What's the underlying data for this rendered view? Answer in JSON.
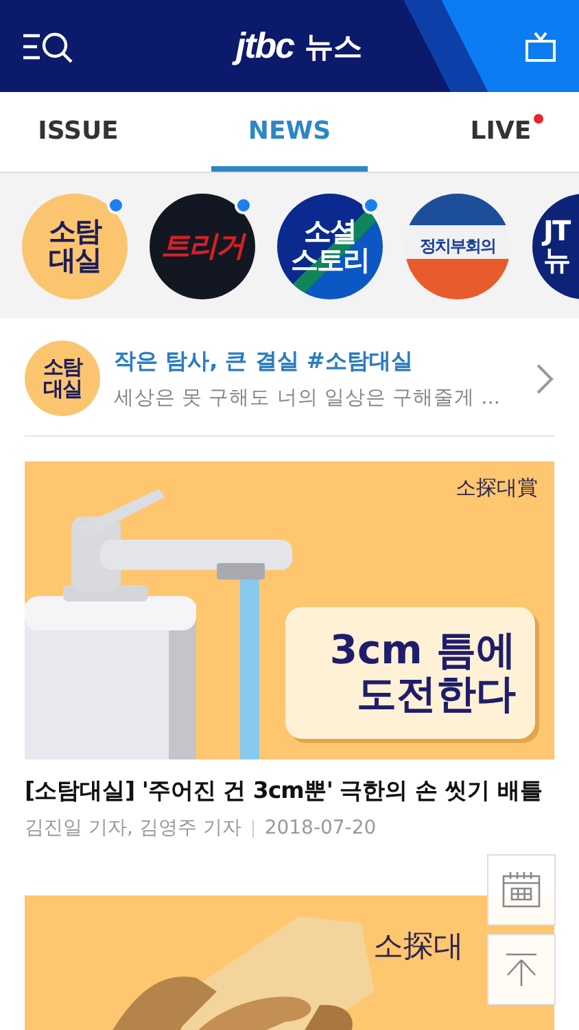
{
  "header": {
    "logo": "jtbc",
    "logo_suffix": "뉴스"
  },
  "tabs": [
    {
      "label": "ISSUE",
      "selected": false,
      "dot": false
    },
    {
      "label": "NEWS",
      "selected": true,
      "dot": false
    },
    {
      "label": "LIVE",
      "selected": false,
      "dot": true
    }
  ],
  "channels": [
    {
      "kind": "sotam",
      "lines": [
        "소탐",
        "대실"
      ],
      "new": true
    },
    {
      "kind": "trigger",
      "lines": [
        "트리거"
      ],
      "new": true
    },
    {
      "kind": "social",
      "lines": [
        "소셜",
        "스토리"
      ],
      "new": true
    },
    {
      "kind": "politics",
      "lines": [
        "정치부회의"
      ],
      "new": false
    },
    {
      "kind": "jtbc",
      "lines": [
        "JT",
        "뉴"
      ],
      "new": false
    }
  ],
  "section": {
    "avatar_lines": [
      "소탐",
      "대실"
    ],
    "title": "작은 탐사, 큰 결실 #소탐대실",
    "subtitle": "세상은 못 구해도 너의 일상은 구해줄게 ..."
  },
  "articles": [
    {
      "kind": "faucet",
      "brand": "소探대賞",
      "overlay_lines": [
        "3cm 틈에",
        "도전한다"
      ],
      "title": "[소탐대실] '주어진 건 3cm뿐' 극한의 손 씻기 배틀",
      "byline": "김진일 기자, 김영주 기자",
      "date": "2018-07-20"
    },
    {
      "kind": "towel",
      "brand": "소探대"
    }
  ]
}
